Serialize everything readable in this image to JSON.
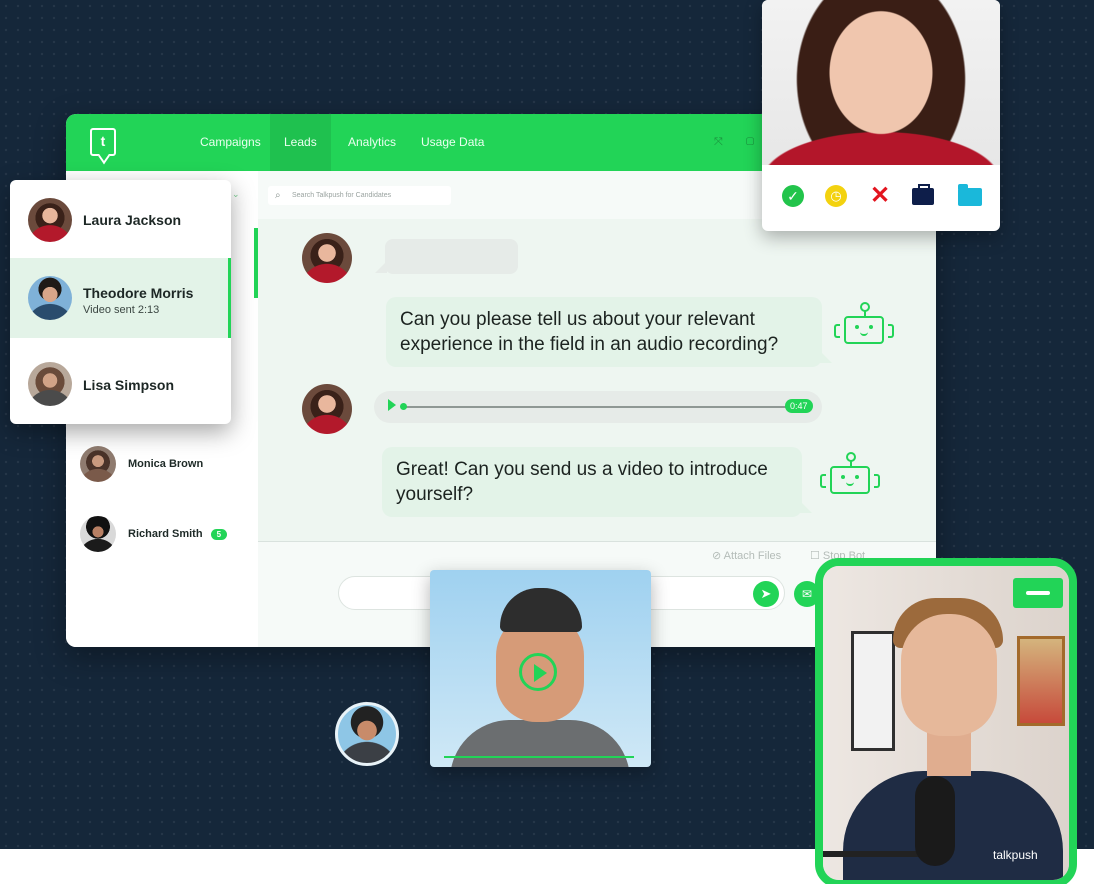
{
  "app": {
    "nav": [
      "Campaigns",
      "Leads",
      "Analytics",
      "Usage Data"
    ],
    "active_nav": "Leads",
    "search_placeholder": "Search Talkpush for Candidates",
    "attach_label": "Attach Files",
    "stop_bot_label": "Stop Bot"
  },
  "contacts": [
    {
      "name": "Laura Jackson",
      "subtitle": ""
    },
    {
      "name": "Theodore Morris",
      "subtitle": "Video sent 2:13"
    },
    {
      "name": "Lisa Simpson",
      "subtitle": ""
    }
  ],
  "leads": [
    {
      "name": "Monica Brown",
      "badge": ""
    },
    {
      "name": "Richard Smith",
      "badge": "5"
    }
  ],
  "chat": {
    "question1": "Can you please tell us about your relevant experience in the field in an audio recording?",
    "audio_duration": "0:47",
    "question2": "Great! Can you send us a video to introduce yourself?"
  },
  "recruiter_video": {
    "brand_text": "talkpush"
  },
  "colors": {
    "brand_green": "#22d457",
    "background": "#15273a",
    "approve": "#22c44b",
    "pending": "#f3d20f",
    "reject": "#e3141e",
    "hire": "#0e1e4a",
    "folder": "#1ab8da"
  },
  "icons": [
    "check-icon",
    "clock-icon",
    "close-icon",
    "briefcase-icon",
    "folder-icon",
    "search-icon",
    "paperclip-icon",
    "robot-icon",
    "send-icon",
    "mail-icon",
    "play-icon",
    "minimize-icon"
  ]
}
